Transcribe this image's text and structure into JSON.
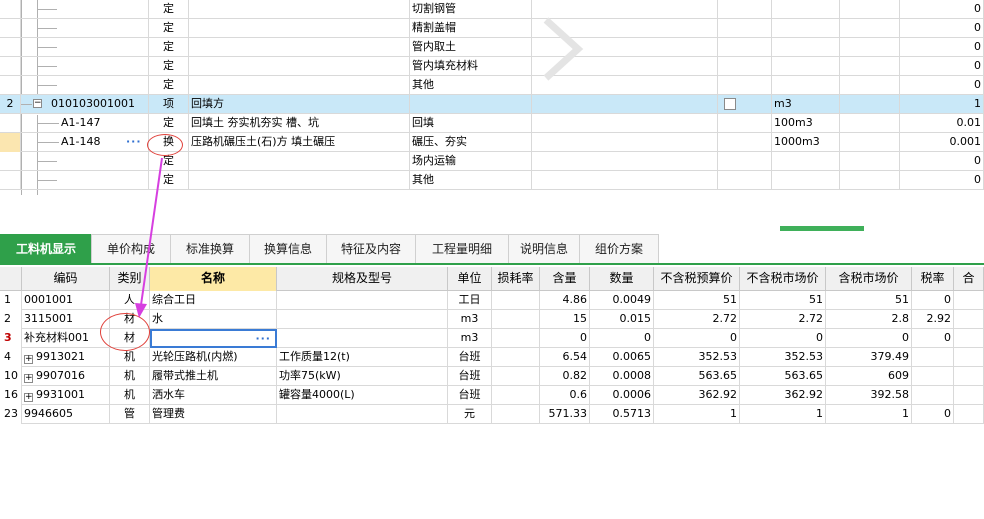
{
  "top_grid": {
    "rows": [
      {
        "unit_type": "定",
        "name": "",
        "feature": "切割钢管",
        "unit": "",
        "qty": "0"
      },
      {
        "unit_type": "定",
        "name": "",
        "feature": "精割盖帽",
        "unit": "",
        "qty": "0"
      },
      {
        "unit_type": "定",
        "name": "",
        "feature": "管内取土",
        "unit": "",
        "qty": "0"
      },
      {
        "unit_type": "定",
        "name": "",
        "feature": "管内填充材料",
        "unit": "",
        "qty": "0"
      },
      {
        "unit_type": "定",
        "name": "",
        "feature": "其他",
        "unit": "",
        "qty": "0"
      },
      {
        "rownum": "2",
        "code": "010103001001",
        "unit_type": "项",
        "name": "回填方",
        "feature": "",
        "unit": "m3",
        "qty": "1"
      },
      {
        "code": "A1-147",
        "unit_type": "定",
        "name": "回填土 夯实机夯实 槽、坑",
        "feature": "回填",
        "unit": "100m3",
        "qty": "0.01"
      },
      {
        "code": "A1-148",
        "code_btn": "···",
        "unit_type": "换",
        "name": "压路机碾压土(石)方 填土碾压",
        "feature": "碾压、夯实",
        "unit": "1000m3",
        "qty": "0.001"
      },
      {
        "unit_type": "定",
        "name": "",
        "feature": "场内运输",
        "unit": "",
        "qty": "0"
      },
      {
        "unit_type": "定",
        "name": "",
        "feature": "其他",
        "unit": "",
        "qty": "0"
      }
    ]
  },
  "tabs": [
    {
      "label": "工料机显示",
      "active": true
    },
    {
      "label": "单价构成"
    },
    {
      "label": "标准换算"
    },
    {
      "label": "换算信息"
    },
    {
      "label": "特征及内容"
    },
    {
      "label": "工程量明细"
    },
    {
      "label": "说明信息"
    },
    {
      "label": "组价方案"
    }
  ],
  "bottom_grid": {
    "headers": [
      "",
      "编码",
      "类别",
      "名称",
      "规格及型号",
      "单位",
      "损耗率",
      "含量",
      "数量",
      "不含税预算价",
      "不含税市场价",
      "含税市场价",
      "税率",
      "合"
    ],
    "rows": [
      {
        "rn": "1",
        "code": "0001001",
        "type": "人",
        "name": "综合工日",
        "spec": "",
        "unit": "工日",
        "loss": "",
        "content": "4.86",
        "qty": "0.0049",
        "budget": "51",
        "market": "51",
        "tax_market": "51",
        "tax_rate": "0"
      },
      {
        "rn": "2",
        "code": "3115001",
        "type": "材",
        "name": "水",
        "spec": "",
        "unit": "m3",
        "loss": "",
        "content": "15",
        "qty": "0.015",
        "budget": "2.72",
        "market": "2.72",
        "tax_market": "2.8",
        "tax_rate": "2.92"
      },
      {
        "rn": "3",
        "code": "补充材料001",
        "type": "材",
        "name": "",
        "name_btn": "···",
        "spec": "",
        "unit": "m3",
        "loss": "",
        "content": "0",
        "qty": "0",
        "budget": "0",
        "market": "0",
        "tax_market": "0",
        "tax_rate": "0"
      },
      {
        "rn": "4",
        "plus": "+",
        "code": "9913021",
        "type": "机",
        "name": "光轮压路机(内燃)",
        "spec": "工作质量12(t)",
        "unit": "台班",
        "loss": "",
        "content": "6.54",
        "qty": "0.0065",
        "budget": "352.53",
        "market": "352.53",
        "tax_market": "379.49",
        "tax_rate": ""
      },
      {
        "rn": "10",
        "plus": "+",
        "code": "9907016",
        "type": "机",
        "name": "履带式推土机",
        "spec": "功率75(kW)",
        "unit": "台班",
        "loss": "",
        "content": "0.82",
        "qty": "0.0008",
        "budget": "563.65",
        "market": "563.65",
        "tax_market": "609",
        "tax_rate": ""
      },
      {
        "rn": "16",
        "plus": "+",
        "code": "9931001",
        "type": "机",
        "name": "洒水车",
        "spec": "罐容量4000(L)",
        "unit": "台班",
        "loss": "",
        "content": "0.6",
        "qty": "0.0006",
        "budget": "362.92",
        "market": "362.92",
        "tax_market": "392.58",
        "tax_rate": ""
      },
      {
        "rn": "23",
        "code": "9946605",
        "type": "管",
        "name": "管理费",
        "spec": "",
        "unit": "元",
        "loss": "",
        "content": "571.33",
        "qty": "0.5713",
        "budget": "1",
        "market": "1",
        "tax_market": "1",
        "tax_rate": "0"
      }
    ]
  },
  "colors": {
    "accent": "#2fa04a",
    "highlight_row": "#c9e8f8",
    "annotation": "#e0403a",
    "arrow": "#d63fe0"
  },
  "icons": {
    "watermark": "chevron-right-icon",
    "expand": "minus-box-icon",
    "row_expand": "plus-box-icon"
  }
}
